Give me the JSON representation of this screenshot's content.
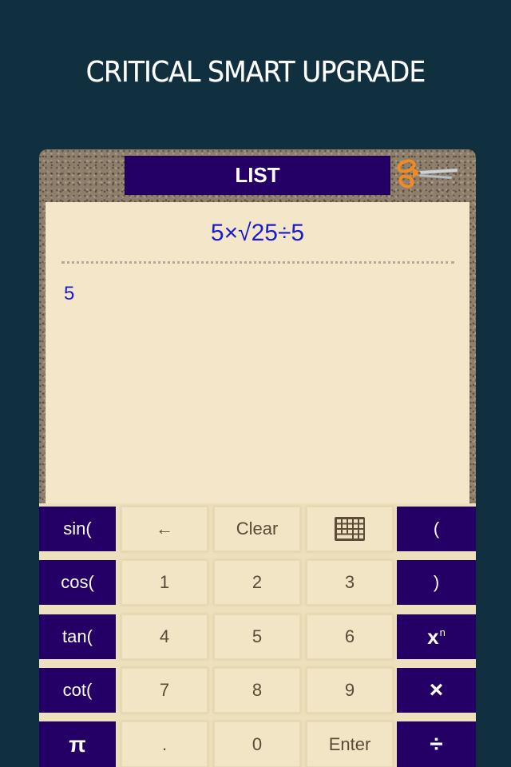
{
  "headline": "CRITICAL SMART UPGRADE",
  "app": {
    "title": "LIST",
    "scissors_icon": "scissors-icon",
    "expression": "5×√25÷5",
    "result": "5"
  },
  "colors": {
    "background": "#11303f",
    "key_purple": "#240066",
    "paper": "#f3e6c9",
    "expression_text": "#1a1ad0",
    "key_text": "#5a4a38"
  },
  "keypad": {
    "rows": [
      [
        {
          "label": "sin(",
          "type": "fn",
          "name": "sin-key"
        },
        {
          "label": "←",
          "type": "num",
          "name": "backspace-key"
        },
        {
          "label": "Clear",
          "type": "num",
          "name": "clear-key"
        },
        {
          "label": "",
          "type": "num",
          "name": "keyboard-toggle-key",
          "icon": "keyboard-icon"
        },
        {
          "label": "(",
          "type": "fn",
          "name": "open-paren-key"
        }
      ],
      [
        {
          "label": "cos(",
          "type": "fn",
          "name": "cos-key"
        },
        {
          "label": "1",
          "type": "num",
          "name": "digit-1-key"
        },
        {
          "label": "2",
          "type": "num",
          "name": "digit-2-key"
        },
        {
          "label": "3",
          "type": "num",
          "name": "digit-3-key"
        },
        {
          "label": ")",
          "type": "fn",
          "name": "close-paren-key"
        }
      ],
      [
        {
          "label": "tan(",
          "type": "fn",
          "name": "tan-key"
        },
        {
          "label": "4",
          "type": "num",
          "name": "digit-4-key"
        },
        {
          "label": "5",
          "type": "num",
          "name": "digit-5-key"
        },
        {
          "label": "6",
          "type": "num",
          "name": "digit-6-key"
        },
        {
          "label": "x",
          "sup": "n",
          "type": "fn",
          "name": "power-key"
        }
      ],
      [
        {
          "label": "cot(",
          "type": "fn",
          "name": "cot-key"
        },
        {
          "label": "7",
          "type": "num",
          "name": "digit-7-key"
        },
        {
          "label": "8",
          "type": "num",
          "name": "digit-8-key"
        },
        {
          "label": "9",
          "type": "num",
          "name": "digit-9-key"
        },
        {
          "label": "×",
          "type": "fn",
          "name": "multiply-key"
        }
      ],
      [
        {
          "label": "π",
          "type": "fn",
          "name": "pi-key"
        },
        {
          "label": ".",
          "type": "num",
          "name": "decimal-key"
        },
        {
          "label": "0",
          "type": "num",
          "name": "digit-0-key"
        },
        {
          "label": "Enter",
          "type": "num",
          "name": "enter-key"
        },
        {
          "label": "÷",
          "type": "fn",
          "name": "divide-key"
        }
      ]
    ]
  }
}
